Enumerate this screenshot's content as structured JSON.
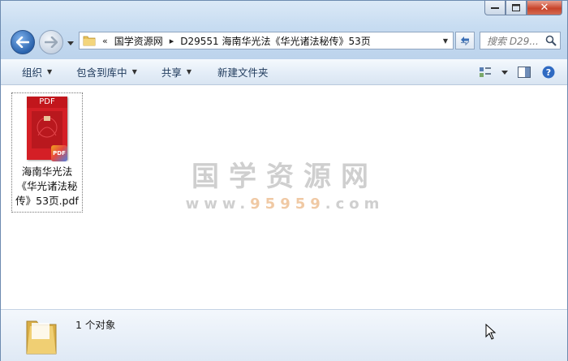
{
  "window": {
    "caption_buttons": [
      "minimize",
      "maximize",
      "close"
    ],
    "close_glyph": "✕"
  },
  "nav": {
    "back_icon": "back-arrow-icon",
    "forward_icon": "forward-arrow-icon"
  },
  "address": {
    "prefix": "«",
    "crumbs": [
      "国学资源网",
      "D29551 海南华光法《华光诸法秘传》53页"
    ],
    "separator": "▸"
  },
  "search": {
    "placeholder": "搜索 D29..."
  },
  "toolbar": {
    "organize": "组织",
    "include_library": "包含到库中",
    "share": "共享",
    "new_folder": "新建文件夹"
  },
  "files": [
    {
      "name": "海南华光法《华光诸法秘传》53页.pdf",
      "thumb_label": "PDF",
      "badge": "PDF"
    }
  ],
  "watermark": {
    "line1": "国学资源网",
    "line2_prefix": "www.",
    "line2_num": "95959",
    "line2_suffix": ".com"
  },
  "details": {
    "count": "1 个对象"
  },
  "colors": {
    "accent_blue": "#2a63ad",
    "pdf_red": "#d41f26",
    "close_red": "#c8432a"
  }
}
